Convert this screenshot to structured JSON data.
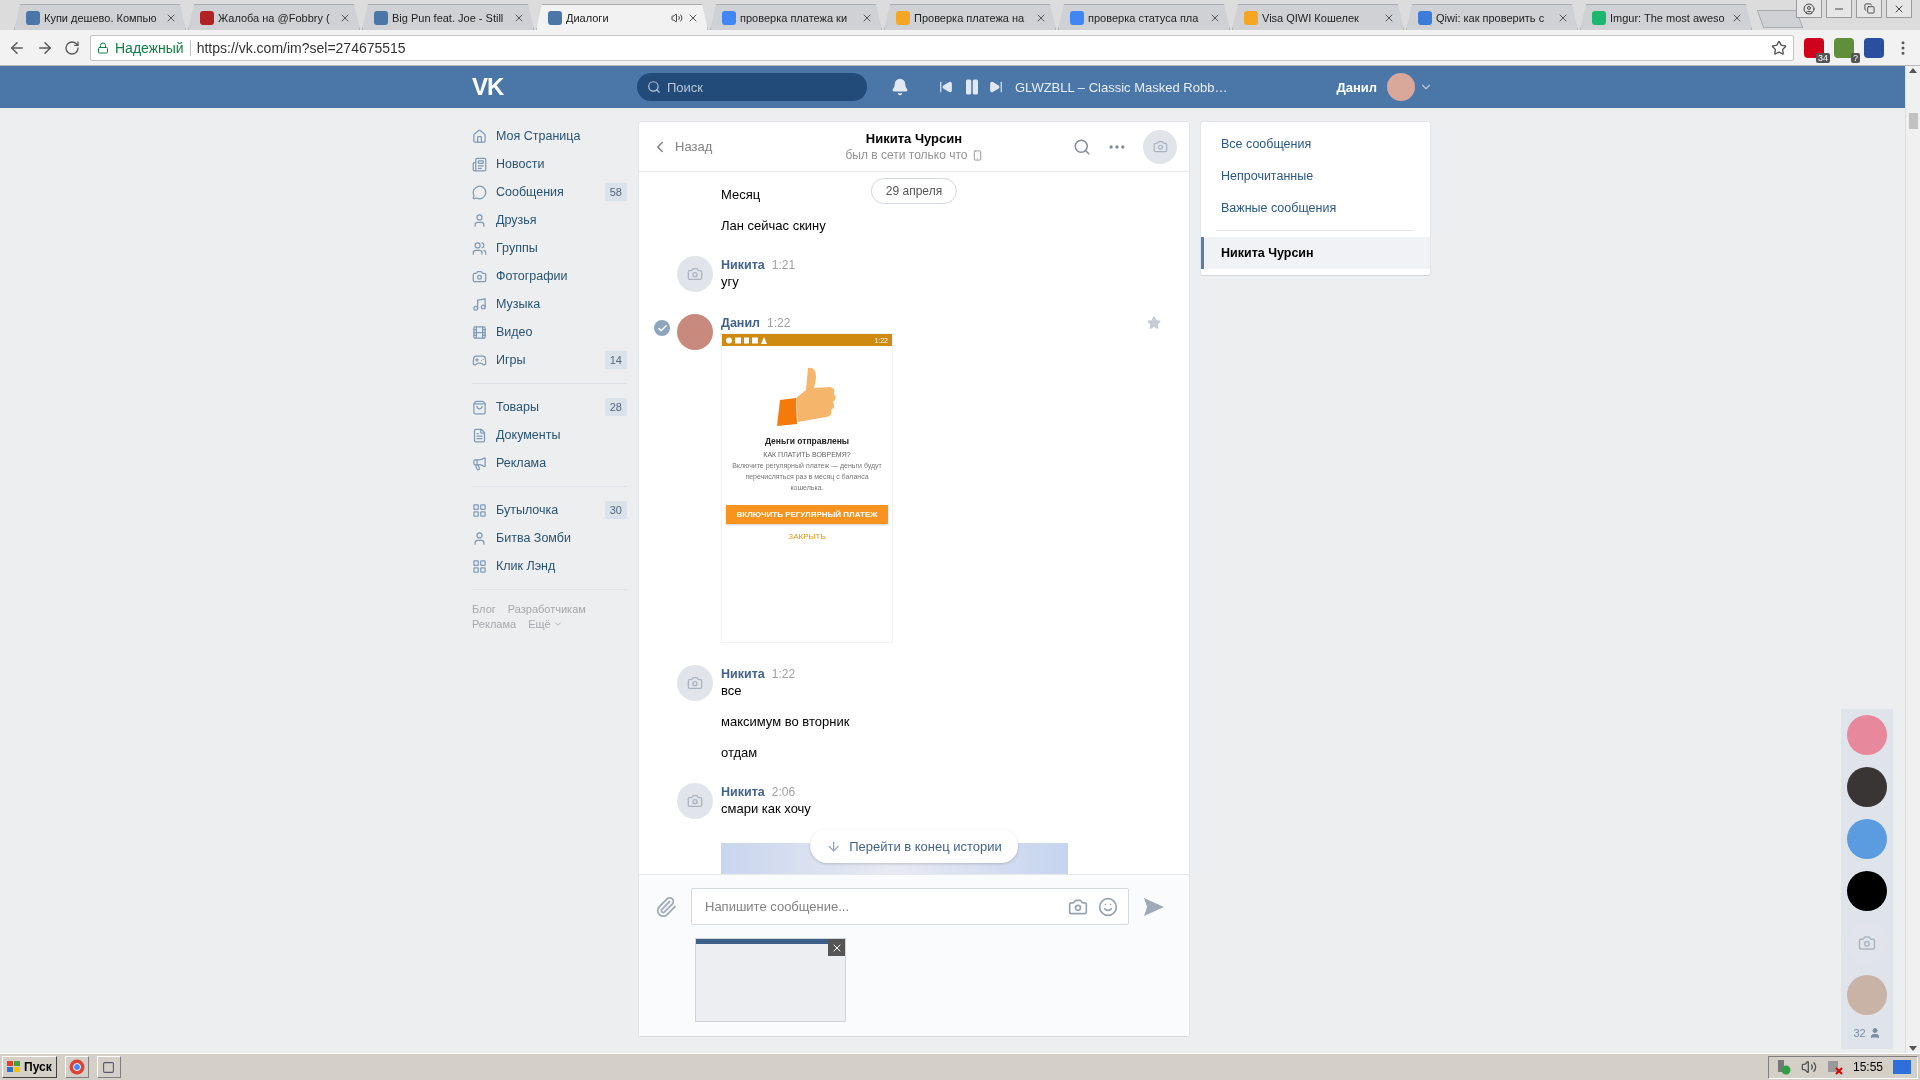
{
  "browser": {
    "tabs": [
      {
        "title": "Купи дешево. Компью",
        "color": "#4a76a8",
        "audio": false,
        "selected": false
      },
      {
        "title": "Жалоба на @Fobbry (",
        "color": "#b22222",
        "audio": false,
        "selected": false
      },
      {
        "title": "Big Pun feat. Joe - Still",
        "color": "#4a76a8",
        "audio": false,
        "selected": false
      },
      {
        "title": "Диалоги",
        "color": "#4a76a8",
        "audio": true,
        "selected": true
      },
      {
        "title": "проверка платежа ки",
        "color": "#4285f4",
        "audio": false,
        "selected": false
      },
      {
        "title": "Проверка платежа на",
        "color": "#f5a623",
        "audio": false,
        "selected": false
      },
      {
        "title": "проверка статуса пла",
        "color": "#4285f4",
        "audio": false,
        "selected": false
      },
      {
        "title": "Visa QIWI Кошелек",
        "color": "#f5a623",
        "audio": false,
        "selected": false
      },
      {
        "title": "Qiwi: как проверить с",
        "color": "#3d7dd8",
        "audio": false,
        "selected": false
      },
      {
        "title": "Imgur: The most aweso",
        "color": "#1bb76e",
        "audio": false,
        "selected": false
      }
    ],
    "address": {
      "security": "Надежный",
      "url": "https://vk.com/im?sel=274675515"
    },
    "extensions": [
      {
        "color": "#d0021b",
        "badge": "34"
      },
      {
        "color": "#5f8f3a",
        "badge": "?"
      },
      {
        "color": "#2a4ea0"
      }
    ]
  },
  "header": {
    "logo": "VK",
    "search": {
      "placeholder": "Поиск"
    },
    "player": {
      "track": "GLWZBLL – Classic Masked Robb…",
      "playing": true
    },
    "user": {
      "name": "Данил"
    }
  },
  "sidebar": {
    "sections": [
      {
        "items": [
          {
            "label": "Моя Страница"
          },
          {
            "label": "Новости"
          },
          {
            "label": "Сообщения",
            "count": "58"
          },
          {
            "label": "Друзья"
          },
          {
            "label": "Группы"
          },
          {
            "label": "Фотографии"
          },
          {
            "label": "Музыка"
          },
          {
            "label": "Видео"
          },
          {
            "label": "Игры",
            "count": "14"
          }
        ]
      },
      {
        "items": [
          {
            "label": "Товары",
            "count": "28"
          },
          {
            "label": "Документы"
          },
          {
            "label": "Реклама"
          }
        ]
      },
      {
        "items": [
          {
            "label": "Бутылочка",
            "count": "30"
          },
          {
            "label": "Битва Зомби"
          },
          {
            "label": "Клик Лэнд"
          }
        ]
      }
    ],
    "footer": [
      "Блог",
      "Разработчикам",
      "Реклама",
      "Ещё"
    ]
  },
  "chat": {
    "back": "Назад",
    "title": "Никита Чурсин",
    "status": "был в сети только что",
    "date": "29 апреля",
    "messages": [
      {
        "kind": "continued",
        "lines": [
          "Месяц",
          "Лан сейчас скину"
        ]
      },
      {
        "kind": "message",
        "author": "Никита",
        "time": "1:21",
        "avatar": {
          "kind": "placeholder"
        },
        "selected": false,
        "lines": [
          "угу"
        ]
      },
      {
        "kind": "message",
        "author": "Данил",
        "time": "1:22",
        "avatar": {
          "kind": "photo"
        },
        "selected": true,
        "starred": false,
        "attachment": {
          "kind": "app-screenshot",
          "clock": "1:22",
          "title": "Деньги отправлены",
          "subtitle": "КАК ПЛАТИТЬ ВОВРЕМЯ?",
          "body": "Включите регулярный платеж — деньги будут перечисляться раз в месяц с баланса кошелька.",
          "button": "ВКЛЮЧИТЬ РЕГУЛЯРНЫЙ ПЛАТЕЖ",
          "link": "ЗАКРЫТЬ"
        }
      },
      {
        "kind": "message",
        "author": "Никита",
        "time": "1:22",
        "avatar": {
          "kind": "placeholder"
        },
        "selected": false,
        "lines": [
          "все",
          "максимум во вторник",
          "отдам"
        ]
      },
      {
        "kind": "message",
        "author": "Никита",
        "time": "2:06",
        "avatar": {
          "kind": "placeholder"
        },
        "selected": false,
        "lines": [
          "смари как хочу"
        ],
        "attachment": {
          "kind": "photo"
        }
      }
    ],
    "jump": "Перейти в конец истории",
    "composer": {
      "placeholder": "Напишите сообщение...",
      "attachments": [
        {
          "kind": "screenshot"
        }
      ]
    }
  },
  "filters": [
    {
      "label": "Все сообщения",
      "selected": false
    },
    {
      "label": "Непрочитанные",
      "selected": false
    },
    {
      "label": "Важные сообщения",
      "selected": false
    }
  ],
  "conversations": [
    {
      "label": "Никита Чурсин",
      "selected": true
    }
  ],
  "friends": {
    "avatars": [
      {
        "kind": "photo",
        "color": "#e8889c"
      },
      {
        "kind": "photo",
        "color": "#3a3535"
      },
      {
        "kind": "photo",
        "color": "#5b9be0"
      },
      {
        "kind": "photo",
        "color": "#000000"
      },
      {
        "kind": "placeholder"
      },
      {
        "kind": "photo",
        "color": "#c9b3a6"
      }
    ],
    "count": "32"
  },
  "taskbar": {
    "start": "Пуск",
    "time": "15:55"
  }
}
